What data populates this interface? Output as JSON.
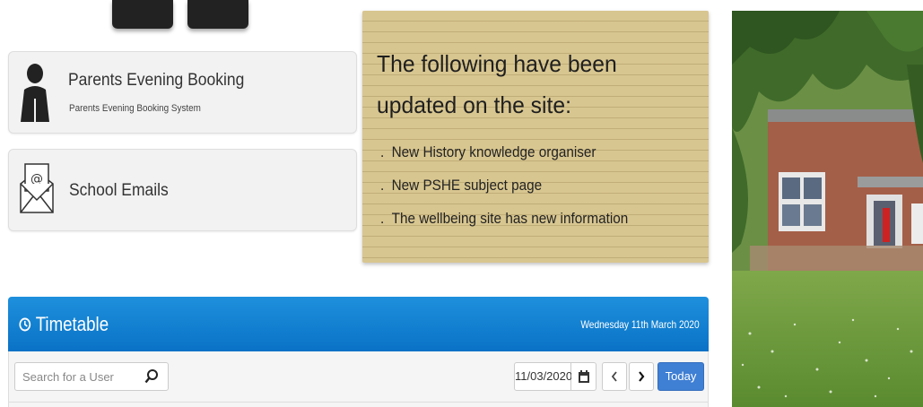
{
  "tiles": [
    {
      "title": "Parents Evening Booking",
      "subtitle": "Parents Evening Booking System",
      "icon": "person-icon"
    },
    {
      "title": "School Emails",
      "icon": "envelope-icon"
    }
  ],
  "notice": {
    "heading": "The following have been updated on the site:",
    "items": [
      "New History knowledge organiser",
      "New PSHE subject page",
      "The wellbeing site has new information"
    ],
    "bullet": "."
  },
  "timetable": {
    "title": "Timetable",
    "date_label": "Wednesday 11th March 2020",
    "search_placeholder": "Search for a User",
    "date_value": "11/03/2020",
    "today_label": "Today",
    "accent": "#1e90dc"
  },
  "photo": {
    "icon": "school-building-photo"
  }
}
